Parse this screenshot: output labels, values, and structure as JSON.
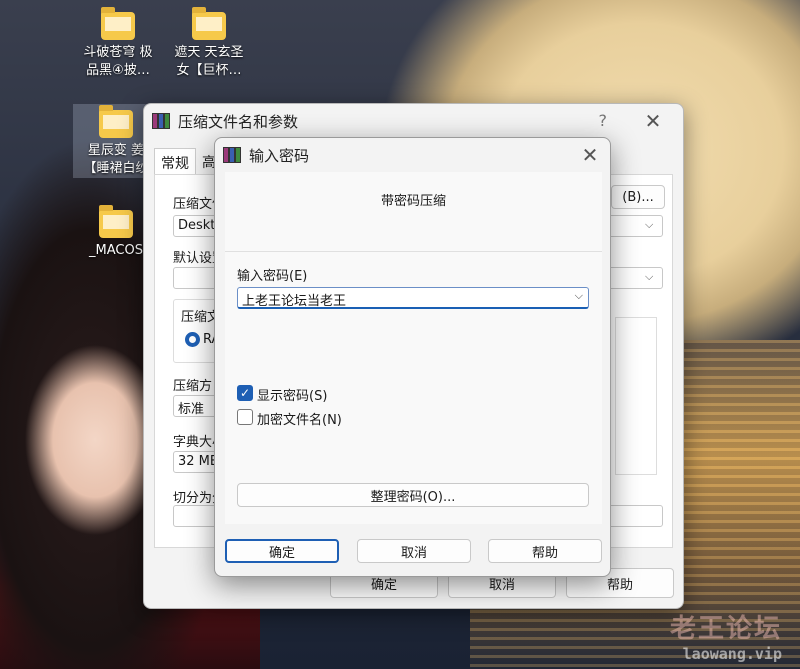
{
  "desktop": {
    "icons": [
      {
        "label_line1": "斗破苍穹 极",
        "label_line2": "品黑④披…"
      },
      {
        "label_line1": "遮天 天玄圣",
        "label_line2": "女【巨杯…"
      },
      {
        "label_line1": "星辰变 姜",
        "label_line2": "【睡裙白纱"
      },
      {
        "label_line1": "_MACOS"
      }
    ],
    "watermark": {
      "main": "老王论坛",
      "url": "laowang.vip"
    }
  },
  "back_window": {
    "title": "压缩文件名和参数",
    "help_glyph": "?",
    "close_glyph": "✕",
    "tabs": [
      "常规",
      "高"
    ],
    "labels": {
      "archive_name": "压缩文件",
      "default_profile": "默认设置",
      "archive_format": "压缩文",
      "compression_method": "压缩方",
      "dictionary_size": "字典大小",
      "split": "切分为分"
    },
    "values": {
      "archive_name": "Deskto",
      "format_option": "RA",
      "method": "标准",
      "dictionary": "32 MB"
    },
    "browse_button": "(B)...",
    "ok": "确定",
    "cancel": "取消",
    "help": "帮助"
  },
  "password_dialog": {
    "title": "输入密码",
    "close_glyph": "✕",
    "heading": "带密码压缩",
    "password_label": "输入密码(E)",
    "password_value": "上老王论坛当老王",
    "show_password_label": "显示密码(S)",
    "show_password_checked": true,
    "encrypt_filenames_label": "加密文件名(N)",
    "encrypt_filenames_checked": false,
    "organize_button": "整理密码(O)...",
    "ok": "确定",
    "cancel": "取消",
    "help": "帮助",
    "check_glyph": "✓",
    "chevron_glyph": "⌵"
  }
}
